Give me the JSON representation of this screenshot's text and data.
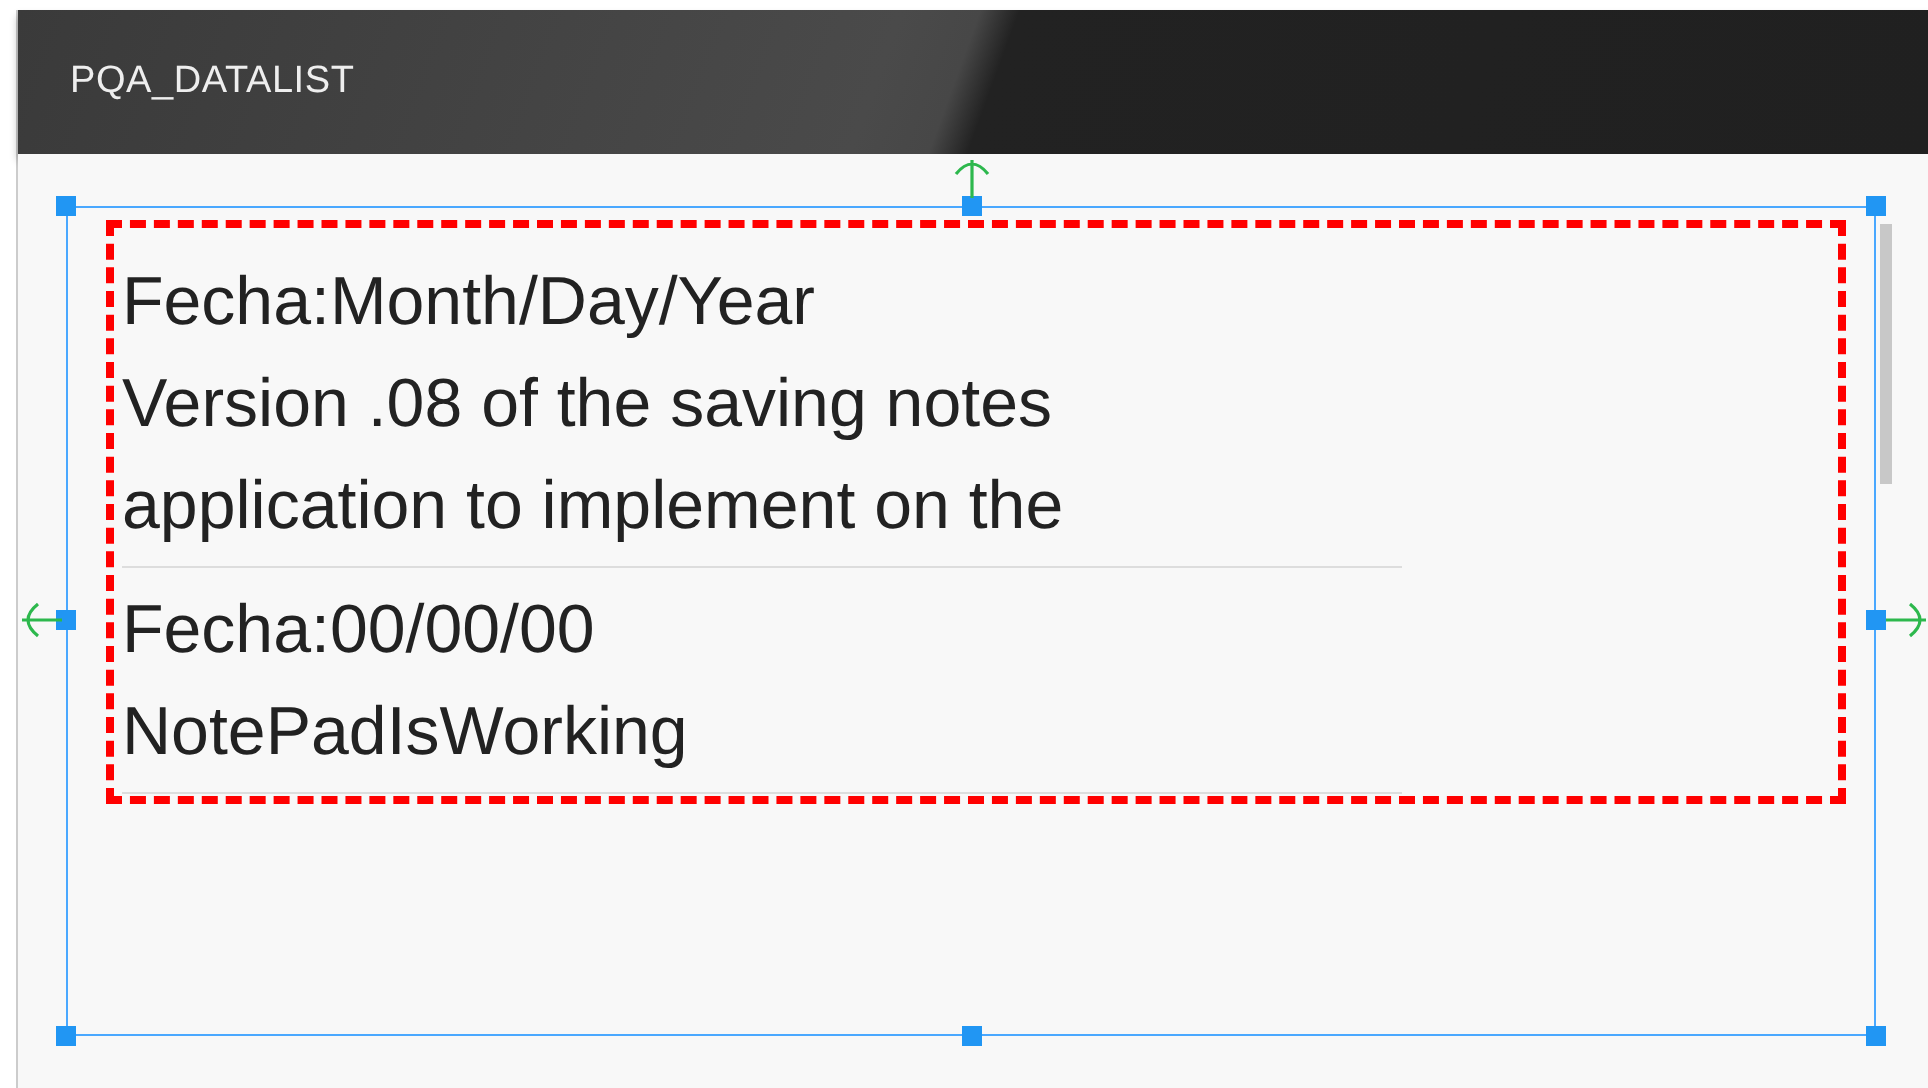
{
  "app_bar": {
    "title": "PQA_DATALIST"
  },
  "notes": [
    {
      "date": "Fecha:Month/Day/Year",
      "text": "Version .08 of the saving notes application to implement on the"
    },
    {
      "date": "Fecha:00/00/00",
      "text": "NotePadIsWorking"
    }
  ]
}
